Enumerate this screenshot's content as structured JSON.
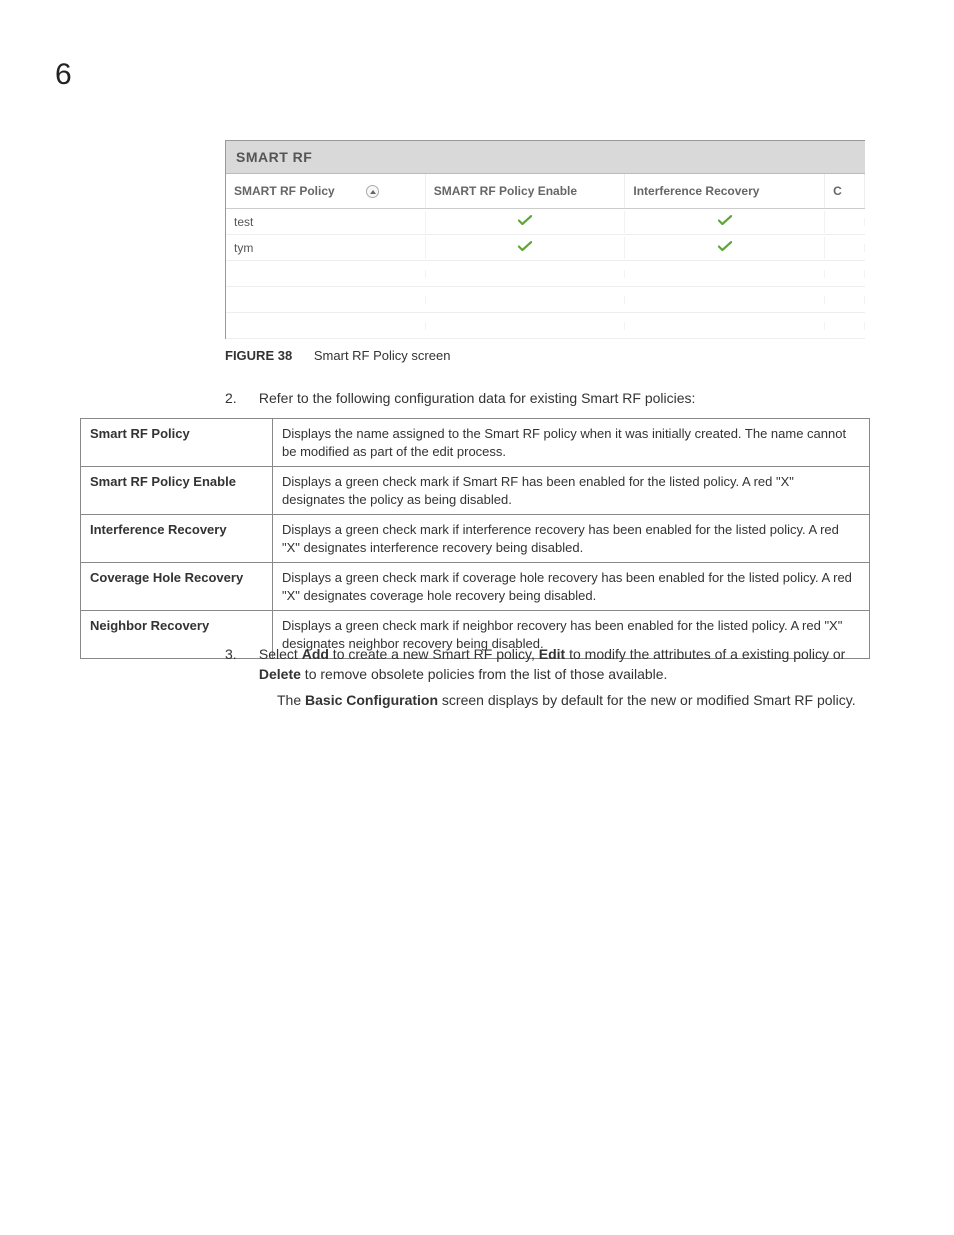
{
  "page_number": "6",
  "screenshot": {
    "title": "SMART RF",
    "headers": {
      "col1": "SMART RF Policy",
      "col2": "SMART RF Policy Enable",
      "col3": "Interference Recovery",
      "col4": "C"
    },
    "rows": [
      {
        "policy": "test",
        "enable": true,
        "interference": true
      },
      {
        "policy": "tym",
        "enable": true,
        "interference": true
      }
    ]
  },
  "figure": {
    "label": "FIGURE 38",
    "caption": "Smart RF Policy screen"
  },
  "step2": {
    "num": "2.",
    "text": "Refer to the following configuration data for existing Smart RF policies:"
  },
  "config_rows": [
    {
      "label": "Smart RF Policy",
      "desc": "Displays the name assigned to the Smart RF policy when it was initially created. The name cannot be modified as part of the edit process."
    },
    {
      "label": "Smart RF Policy Enable",
      "desc": "Displays a green check mark if Smart RF has been enabled for the listed policy. A red \"X\" designates the policy as being disabled."
    },
    {
      "label": "Interference Recovery",
      "desc": "Displays a green check mark if interference recovery has been enabled for the listed policy. A red \"X\" designates interference recovery being disabled."
    },
    {
      "label": "Coverage Hole Recovery",
      "desc": "Displays a green check mark if coverage hole recovery has been enabled for the listed policy. A red \"X\" designates coverage hole recovery being disabled."
    },
    {
      "label": "Neighbor Recovery",
      "desc": "Displays a green check mark if neighbor recovery has been enabled for the listed policy. A red \"X\" designates neighbor recovery being disabled."
    }
  ],
  "step3": {
    "num": "3.",
    "pre": "Select ",
    "add": "Add",
    "mid1": " to create a new Smart RF policy, ",
    "edit": "Edit",
    "mid2": " to modify the attributes of a existing policy or ",
    "delete": "Delete",
    "post": " to remove obsolete policies from the list of those available."
  },
  "sub_para": {
    "pre": "The ",
    "bold": "Basic Configuration",
    "post": " screen displays by default for the new or modified Smart RF policy."
  }
}
